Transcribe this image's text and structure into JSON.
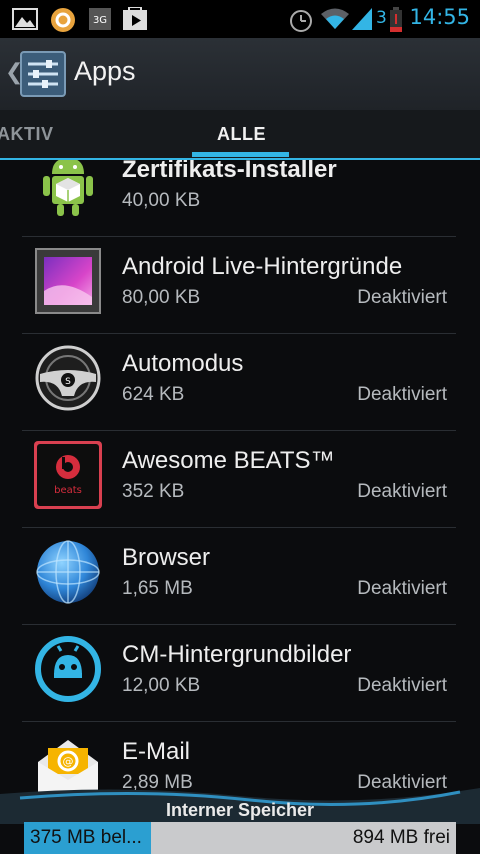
{
  "status_bar": {
    "time": "14:55",
    "network_label": "3G",
    "battery_level": "3",
    "icons": [
      "gallery-icon",
      "browser-circle-icon",
      "3g-notification-icon",
      "play-store-icon",
      "alarm-icon",
      "wifi-icon",
      "signal-icon",
      "battery-icon"
    ]
  },
  "action_bar": {
    "title": "Apps",
    "back_icon": "chevron-left-icon",
    "app_icon": "settings-sliders-icon"
  },
  "tabs": [
    {
      "label": "AKTIV",
      "active": false
    },
    {
      "label": "ALLE",
      "active": true
    }
  ],
  "apps": [
    {
      "name": "Zertifikats-Installer",
      "size": "40,00 KB",
      "status": "",
      "icon": "android-certificate-icon"
    },
    {
      "name": "Android Live-Hintergründe",
      "size": "80,00 KB",
      "status": "Deaktiviert",
      "icon": "live-wallpaper-icon"
    },
    {
      "name": "Automodus",
      "size": "624 KB",
      "status": "Deaktiviert",
      "icon": "steering-wheel-icon"
    },
    {
      "name": "Awesome BEATS™",
      "size": "352 KB",
      "status": "Deaktiviert",
      "icon": "beats-audio-icon"
    },
    {
      "name": "Browser",
      "size": "1,65 MB",
      "status": "Deaktiviert",
      "icon": "globe-icon"
    },
    {
      "name": "CM-Hintergrundbilder",
      "size": "12,00 KB",
      "status": "Deaktiviert",
      "icon": "cyanogenmod-icon"
    },
    {
      "name": "E-Mail",
      "size": "2,89 MB",
      "status": "Deaktiviert",
      "icon": "email-envelope-icon"
    }
  ],
  "storage": {
    "label": "Interner Speicher",
    "used": "375 MB bel...",
    "free": "894 MB frei",
    "used_fraction": 0.295
  },
  "colors": {
    "accent": "#33b5e5",
    "background": "#0b0c0e",
    "storage_used": "#2b9fd1"
  }
}
